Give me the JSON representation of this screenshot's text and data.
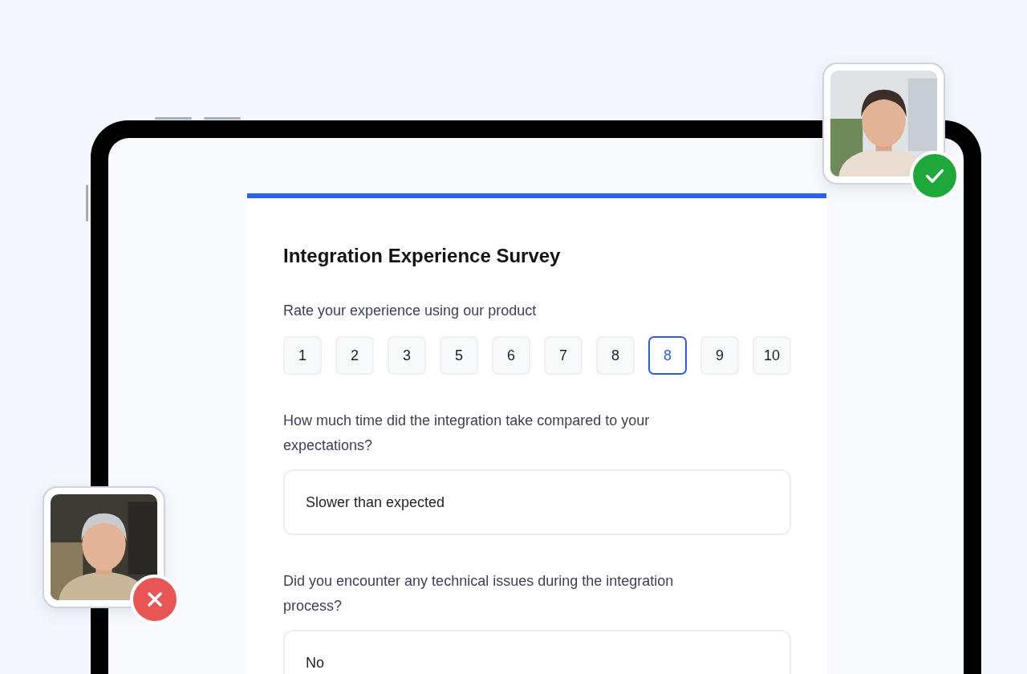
{
  "survey": {
    "title": "Integration Experience Survey",
    "questions": [
      {
        "kind": "rating",
        "label": "Rate your experience using our product",
        "options": [
          {
            "label": "1",
            "selected": false
          },
          {
            "label": "2",
            "selected": false
          },
          {
            "label": "3",
            "selected": false
          },
          {
            "label": "5",
            "selected": false
          },
          {
            "label": "6",
            "selected": false
          },
          {
            "label": "7",
            "selected": false
          },
          {
            "label": "8",
            "selected": false
          },
          {
            "label": "8",
            "selected": true
          },
          {
            "label": "9",
            "selected": false
          },
          {
            "label": "10",
            "selected": false
          }
        ]
      },
      {
        "kind": "answer",
        "label": "How much time did the integration take compared to your expectations?",
        "value": "Slower than expected"
      },
      {
        "kind": "answer",
        "label": "Did you encounter any technical issues during the integration process?",
        "value": "No"
      }
    ]
  },
  "reviewers": [
    {
      "kind": "picture",
      "approved": true
    },
    {
      "kind": "picture",
      "approved": false
    }
  ]
}
